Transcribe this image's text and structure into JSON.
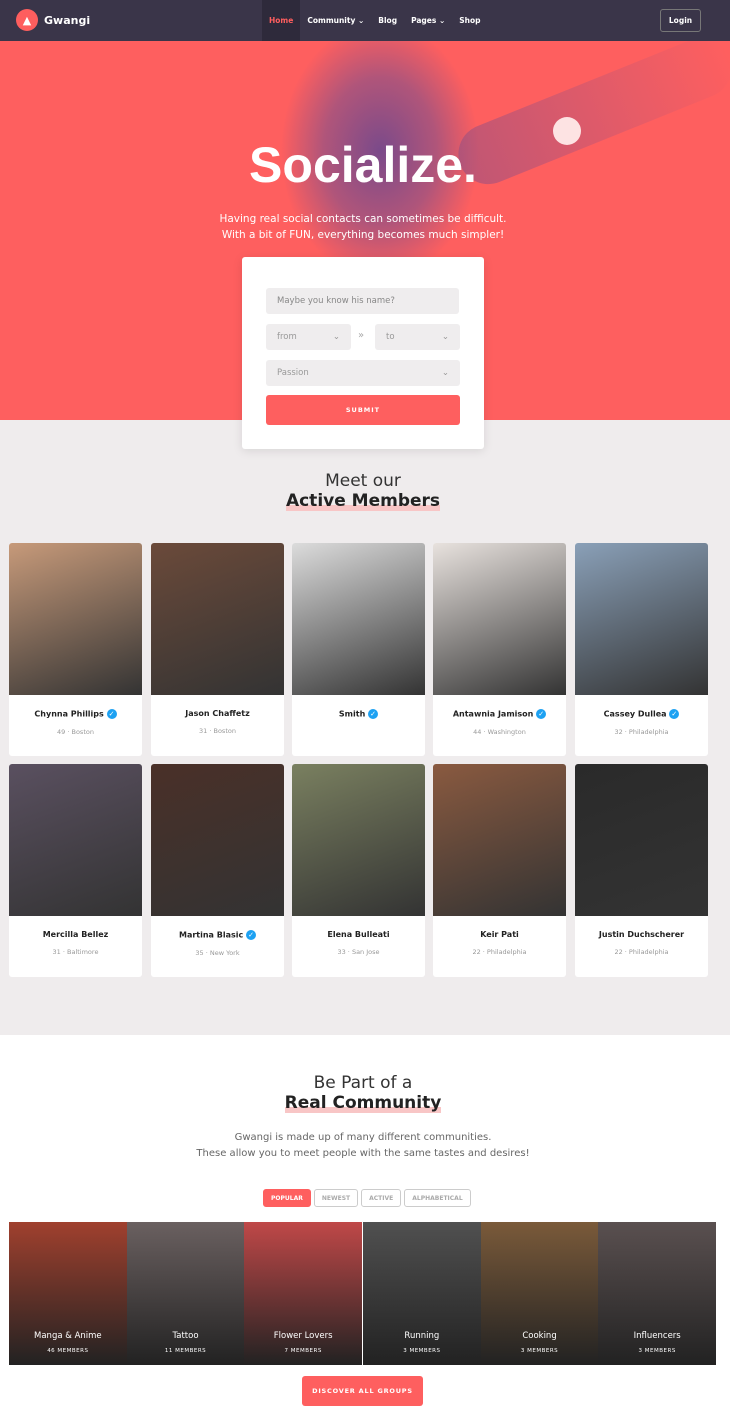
{
  "nav": {
    "brand": "Gwangi",
    "items": [
      "Home",
      "Community ⌄",
      "Blog",
      "Pages ⌄",
      "Shop"
    ],
    "login": "Login"
  },
  "hero": {
    "title": "Socialize.",
    "subtitle_1": "Having real social contacts can sometimes be difficult.",
    "subtitle_2": "With a bit of FUN, everything becomes much simpler!"
  },
  "search": {
    "name_placeholder": "Maybe you know his name?",
    "from": "from",
    "to": "to",
    "passion": "Passion",
    "submit": "SUBMIT"
  },
  "members": {
    "heading_1": "Meet our",
    "heading_2": "Active Members",
    "list": [
      {
        "name": "Chynna Phillips",
        "verified": true,
        "meta": "49 · Boston",
        "photo": "#c79a7a"
      },
      {
        "name": "Jason Chaffetz",
        "verified": false,
        "meta": "31 · Boston",
        "photo": "#6b4a3a"
      },
      {
        "name": "Smith",
        "verified": true,
        "meta": "",
        "photo": "#dcdcdc"
      },
      {
        "name": "Antawnia Jamison",
        "verified": true,
        "meta": "44 · Washington",
        "photo": "#e8e2de"
      },
      {
        "name": "Cassey Dullea",
        "verified": true,
        "meta": "32 · Philadelphia",
        "photo": "#8aa0b8"
      },
      {
        "name": "Mercilla Bellez",
        "verified": false,
        "meta": "31 · Baltimore",
        "photo": "#5a5060"
      },
      {
        "name": "Martina Blasic",
        "verified": true,
        "meta": "35 · New York",
        "photo": "#4a3028"
      },
      {
        "name": "Elena Bulleati",
        "verified": false,
        "meta": "33 · San Jose",
        "photo": "#7a8060"
      },
      {
        "name": "Keir Pati",
        "verified": false,
        "meta": "22 · Philadelphia",
        "photo": "#8a5a40"
      },
      {
        "name": "Justin Duchscherer",
        "verified": false,
        "meta": "22 · Philadelphia",
        "photo": "#2a2a2a"
      }
    ]
  },
  "community": {
    "heading_1": "Be Part of a",
    "heading_2": "Real Community",
    "desc_1": "Gwangi is made up of many different communities.",
    "desc_2": "These allow you to meet people with the same tastes and desires!",
    "tabs": [
      "POPULAR",
      "NEWEST",
      "ACTIVE",
      "ALPHABETICAL"
    ],
    "active_tab": "POPULAR",
    "groups": [
      {
        "name": "Manga & Anime",
        "members": "46 MEMBERS",
        "photo": "#a0402e"
      },
      {
        "name": "Tattoo",
        "members": "11 MEMBERS",
        "photo": "#6a6060"
      },
      {
        "name": "Flower Lovers",
        "members": "7 MEMBERS",
        "photo": "#c04848"
      },
      {
        "name": "Running",
        "members": "3 MEMBERS",
        "photo": "#505050"
      },
      {
        "name": "Cooking",
        "members": "3 MEMBERS",
        "photo": "#7a5a3a"
      },
      {
        "name": "Influencers",
        "members": "3 MEMBERS",
        "photo": "#5a5050"
      }
    ],
    "discover": "DISCOVER ALL GROUPS"
  },
  "colors": {
    "accent": "#fe5f5f",
    "nav": "#3a3549",
    "verified": "#1da1f2"
  }
}
